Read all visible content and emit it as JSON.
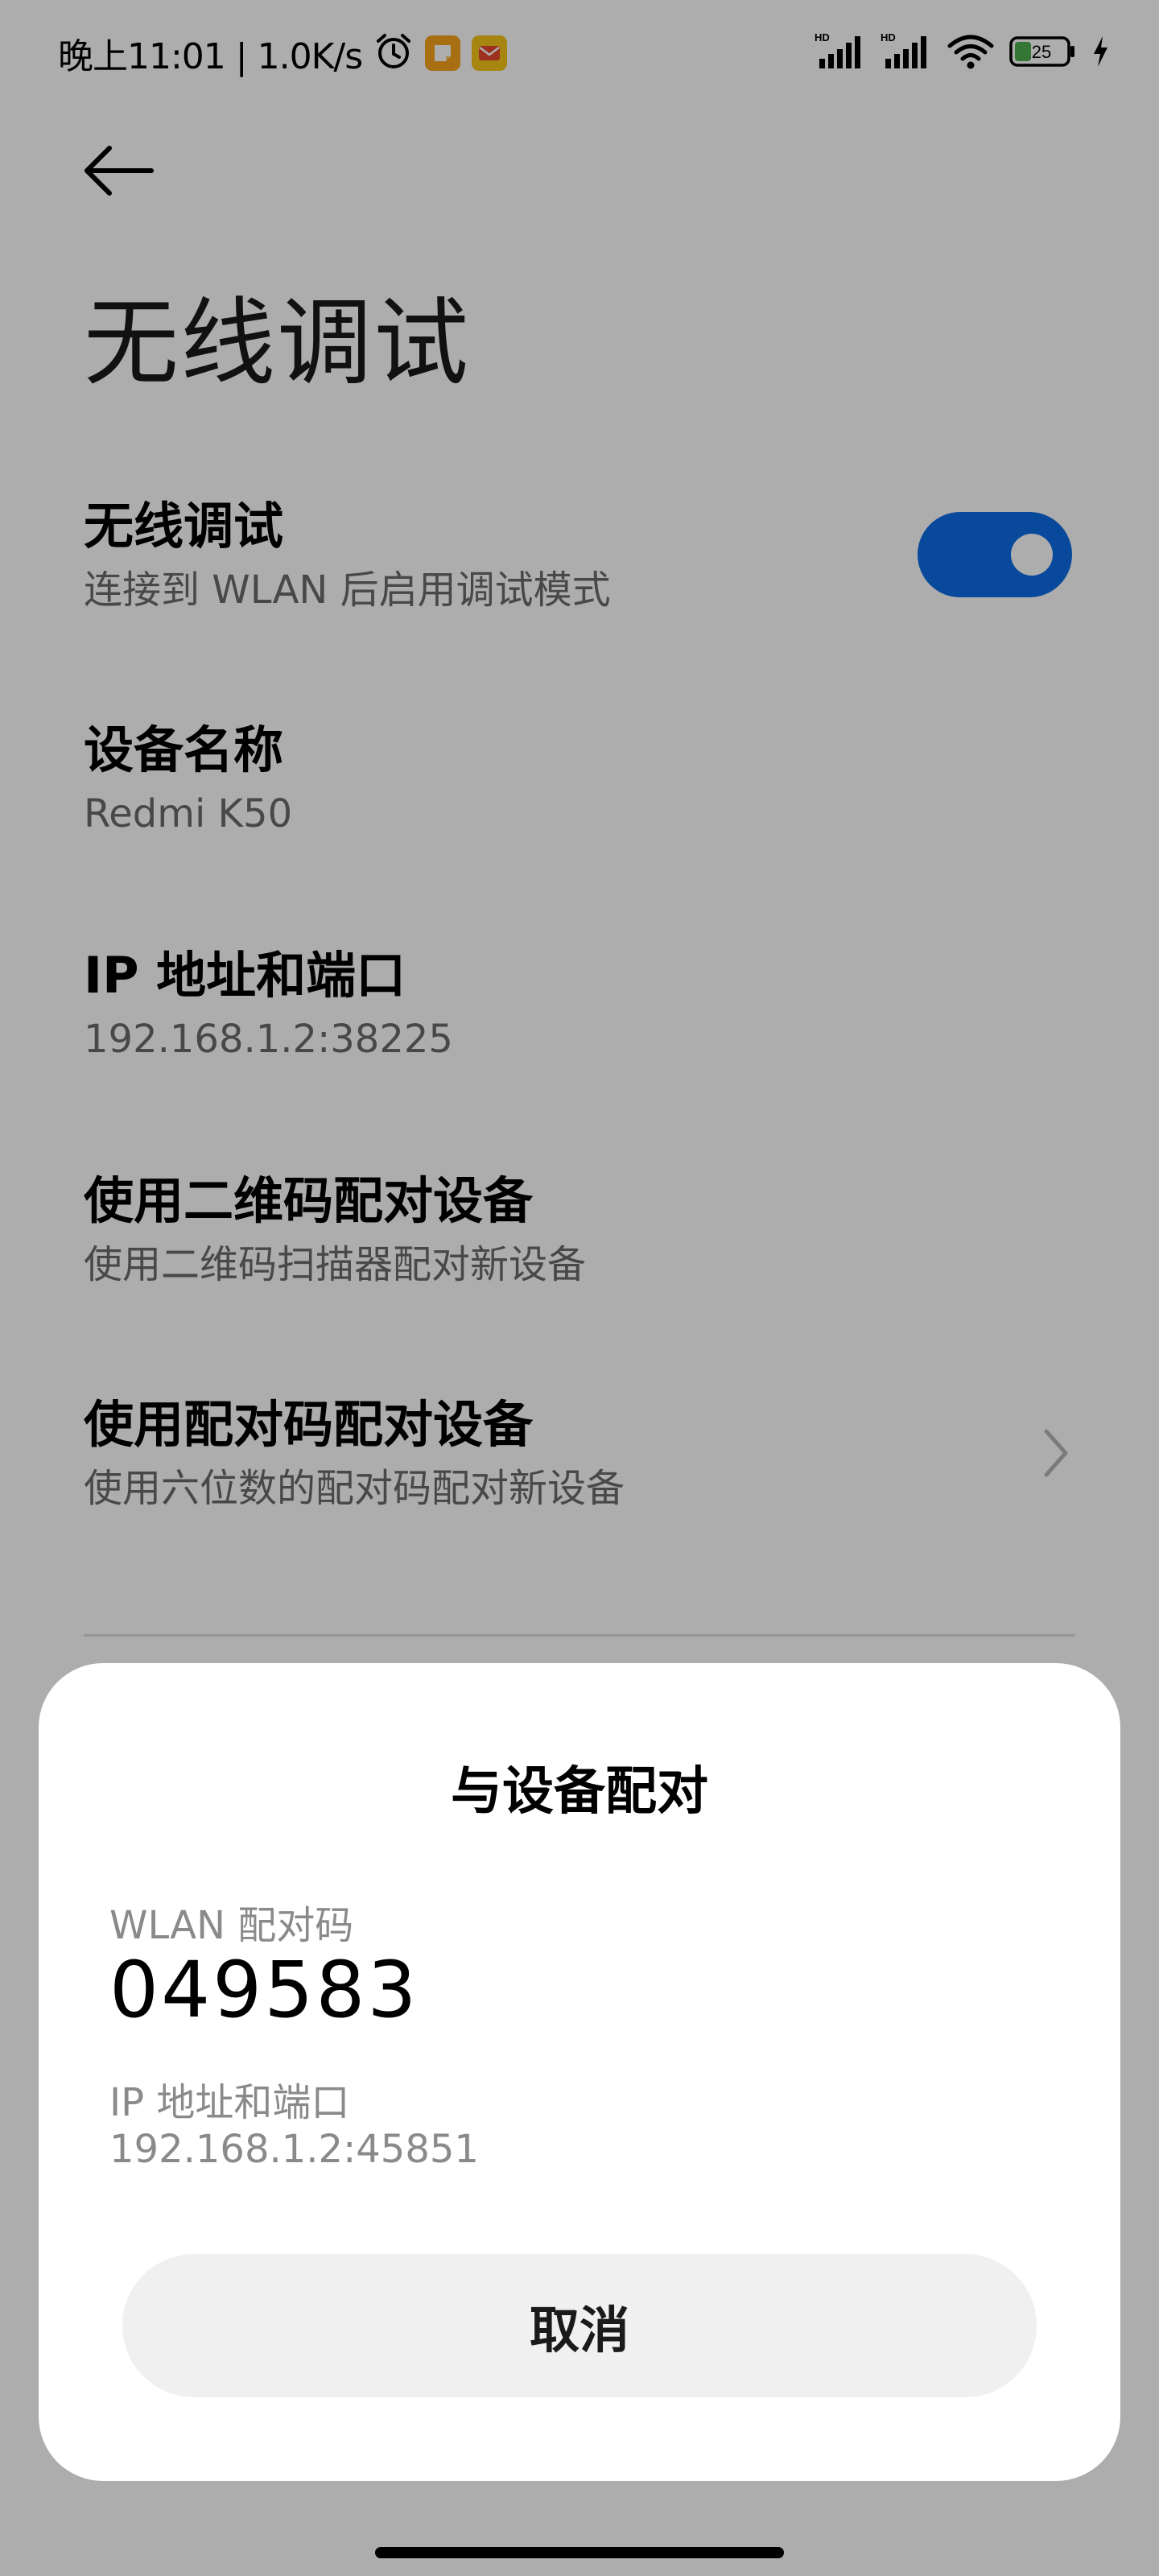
{
  "status_bar": {
    "time_speed": "晚上11:01 | 1.0K/s",
    "signal1_label": "HD",
    "signal2_label": "HD",
    "battery": "25"
  },
  "header": {
    "title": "无线调试"
  },
  "settings": {
    "wireless_debugging": {
      "title": "无线调试",
      "subtitle": "连接到 WLAN 后启用调试模式",
      "enabled": true
    },
    "device_name": {
      "title": "设备名称",
      "value": "Redmi K50"
    },
    "ip_port": {
      "title": "IP 地址和端口",
      "value": "192.168.1.2:38225"
    },
    "qr_pair": {
      "title": "使用二维码配对设备",
      "subtitle": "使用二维码扫描器配对新设备"
    },
    "code_pair": {
      "title": "使用配对码配对设备",
      "subtitle": "使用六位数的配对码配对新设备"
    }
  },
  "dialog": {
    "title": "与设备配对",
    "code_label": "WLAN 配对码",
    "code": "049583",
    "ip_label": "IP 地址和端口",
    "ip_value": "192.168.1.2:45851",
    "cancel_label": "取消"
  },
  "colors": {
    "accent": "#0d6ce6",
    "overlay": "rgba(0,0,0,0.32)",
    "battery_fill": "#4caf50",
    "notif_orange": "#f7a21b",
    "notif_yellow": "#f5c518"
  },
  "icons": [
    "back-arrow-icon",
    "alarm-icon",
    "note-icon",
    "mail-icon",
    "signal-icon",
    "wifi-icon",
    "battery-icon",
    "charging-icon",
    "chevron-right-icon"
  ]
}
